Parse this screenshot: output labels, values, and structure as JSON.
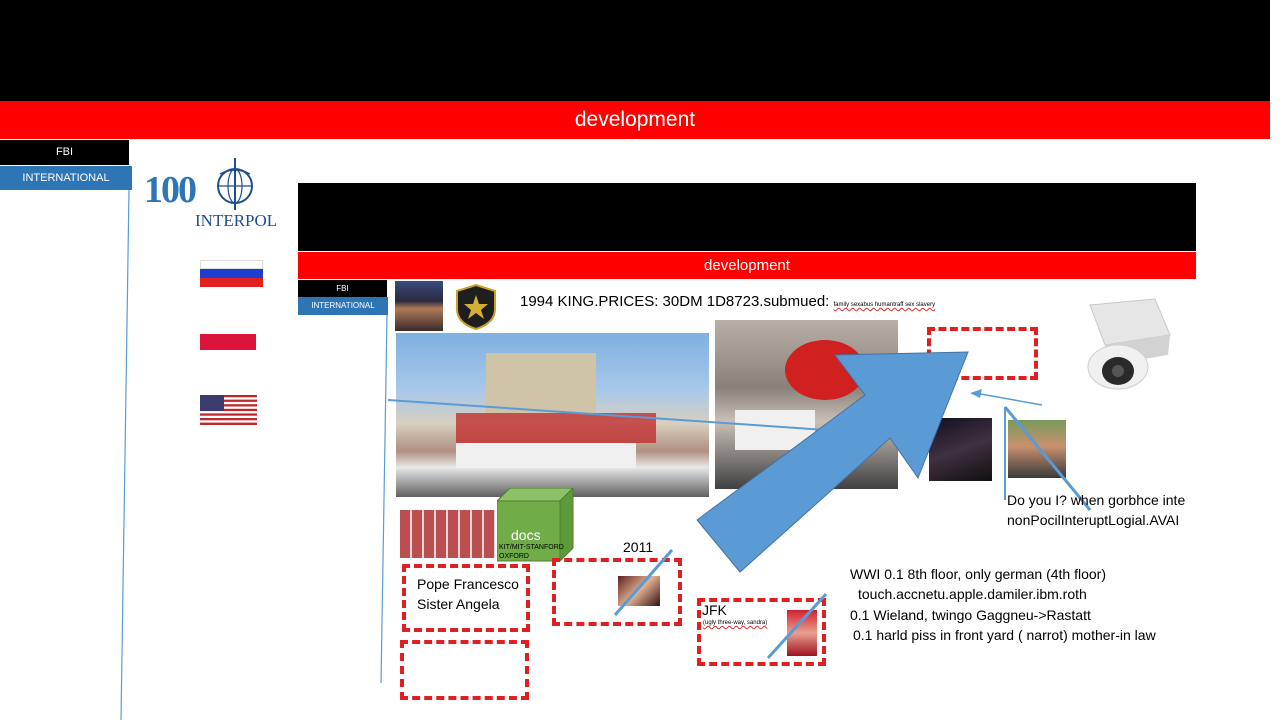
{
  "outer": {
    "banner_label": "development",
    "tab_fbi": "FBI",
    "tab_international": "INTERNATIONAL",
    "interpol_text": "INTERPOL",
    "centenary_text": "100"
  },
  "inner": {
    "banner_label": "development",
    "tab_fbi": "FBI",
    "tab_international": "INTERNATIONAL",
    "headline": "1994 KING.PRICES: 30DM 1D8723.submued:",
    "headline_small": "family sexabus humantraff sex slavery"
  },
  "docs_cube": {
    "label": "docs",
    "sub1": "KIT/MIT-STANFORD",
    "sub2": "OXFORD"
  },
  "labels": {
    "pope": "Pope Francesco",
    "sister": "Sister Angela",
    "year": "2011",
    "jfk": "JFK",
    "jfk_small": "(ugly three-way, sandra)",
    "question_line1": "Do you I? when gorbhce inte",
    "question_line2": "nonPocilInteruptLogial.AVAI"
  },
  "notes": [
    {
      "text": "WWI 0.1 8th floor, only german (4th floor)"
    },
    {
      "text": "touch.accnetu.apple.damiler.ibm.roth"
    },
    {
      "text": "0.1 Wieland, twingo Gaggneu->Rastatt"
    },
    {
      "text": "0.1 harld piss in front yard ( narrot) mother-in law"
    }
  ],
  "colors": {
    "banner_red": "#ff0000",
    "tab_blue": "#2e75b6",
    "arrow_blue": "#5b9bd5",
    "dash_red": "#e02020",
    "cube_green": "#70ad47"
  }
}
